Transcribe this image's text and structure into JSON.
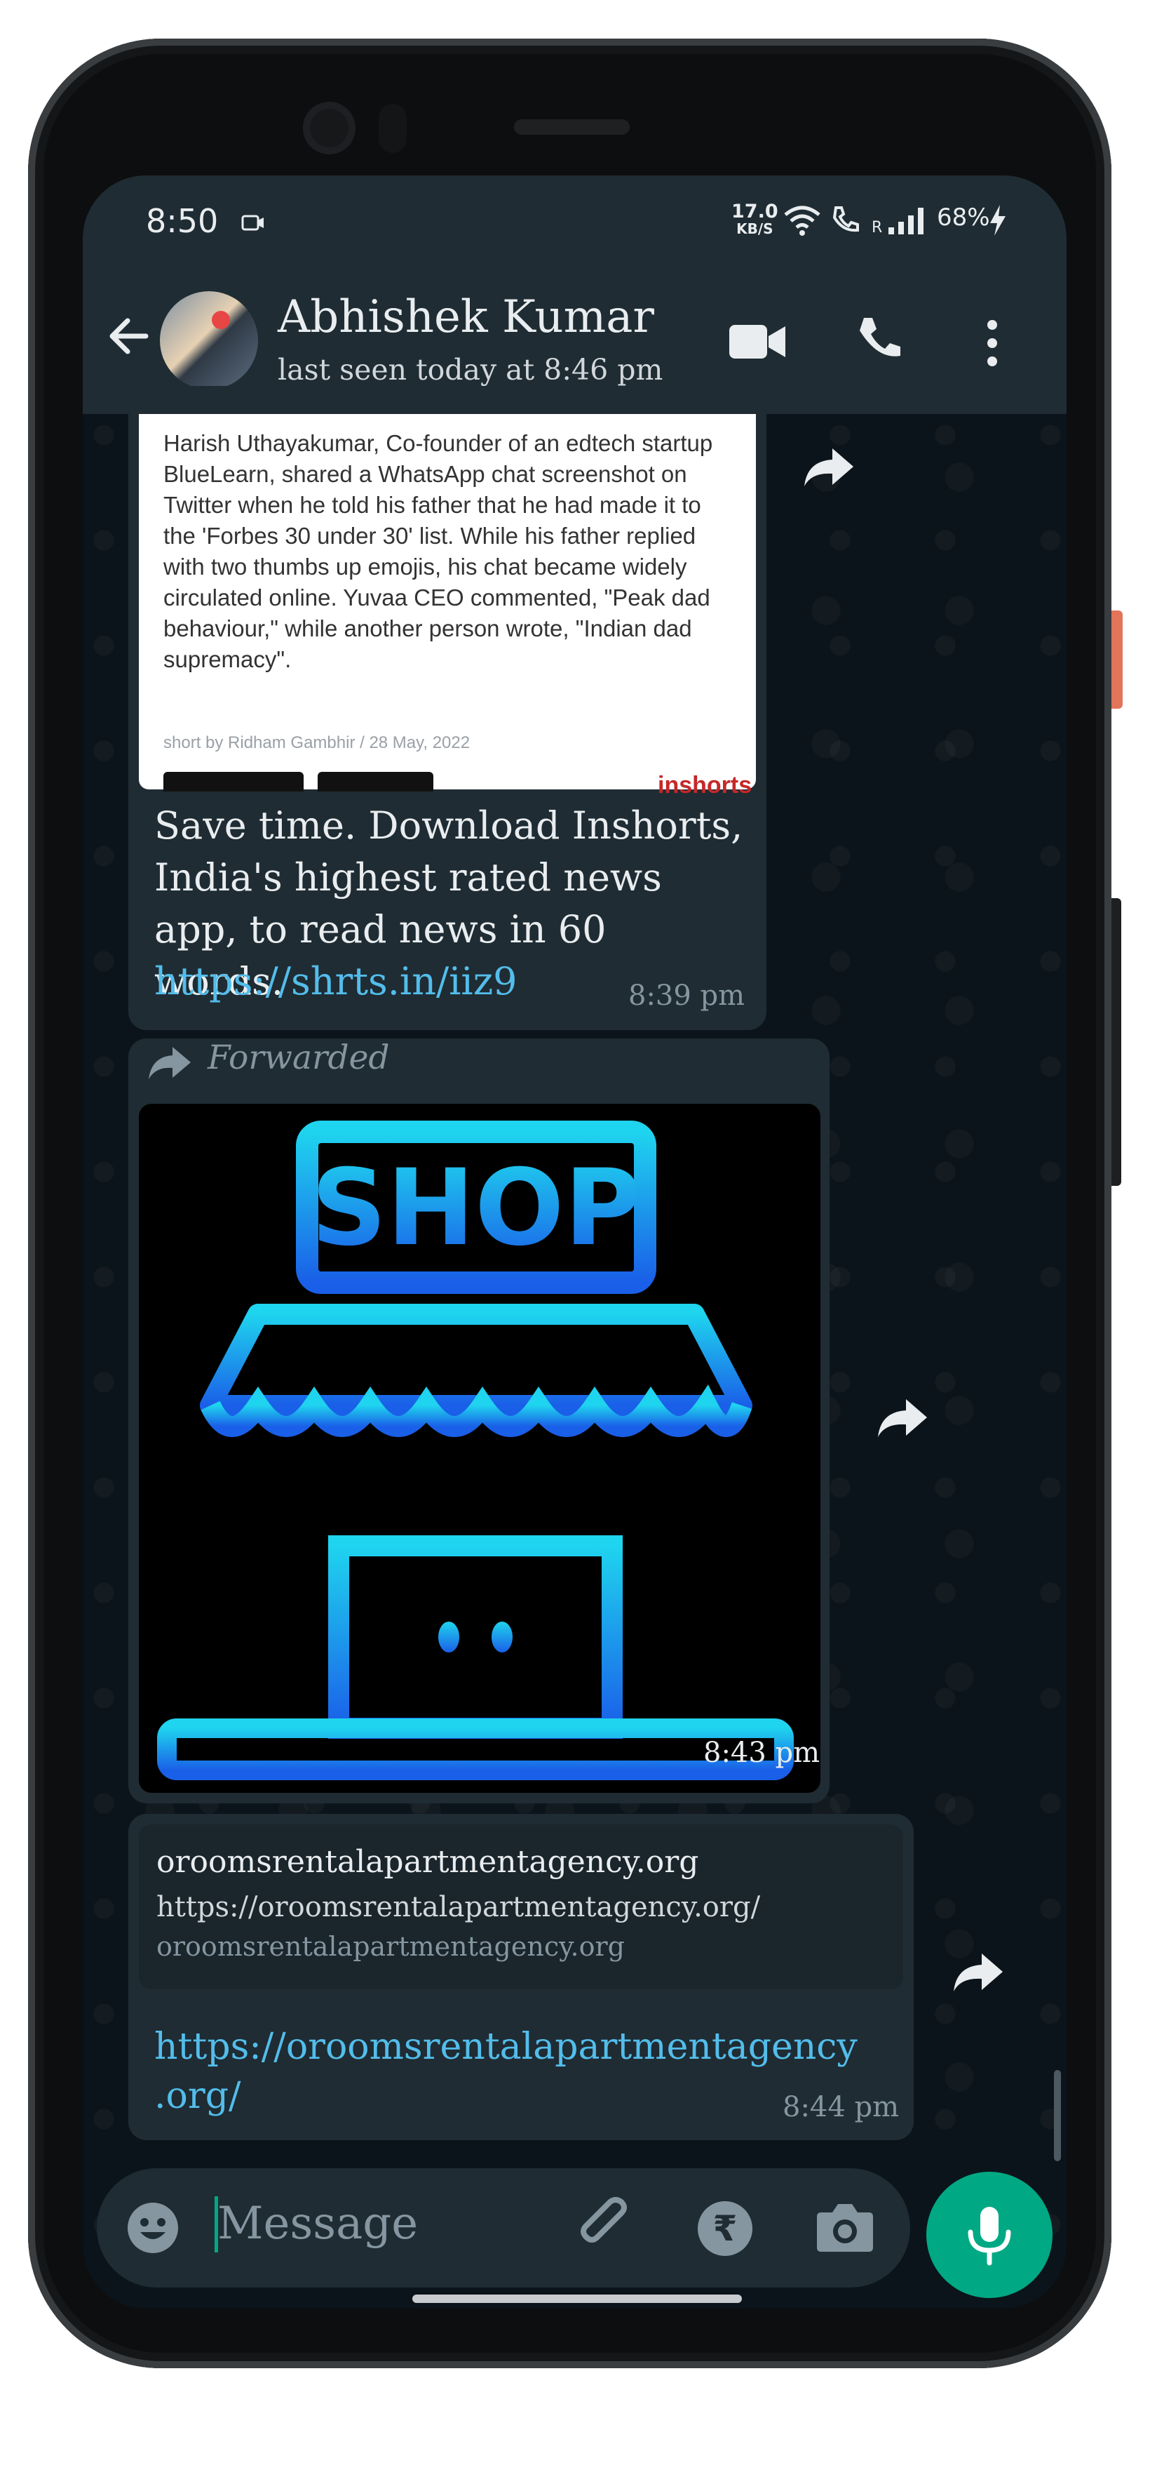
{
  "status_bar": {
    "time": "8:50",
    "net_speed": "17.0",
    "net_unit": "KB/S",
    "signal_label": "R",
    "battery": "68%"
  },
  "header": {
    "contact_name": "Abhishek Kumar",
    "last_seen": "last seen today at 8:46 pm"
  },
  "messages": [
    {
      "type": "news",
      "article": "Harish Uthayakumar, Co-founder of an edtech startup BlueLearn, shared a WhatsApp chat screenshot on Twitter when he told his father that he had made it to the 'Forbes 30 under 30' list. While his father replied with two thumbs up emojis, his chat became widely circulated online. Yuvaa CEO commented, \"Peak dad behaviour,\" while another person wrote, \"Indian dad supremacy\".",
      "byline": "short by Ridham Gambhir / 28 May, 2022",
      "brand": "inshorts",
      "text": "Save time. Download Inshorts, India's highest rated news app, to read news in 60 words.",
      "link": "https://shrts.in/iiz9",
      "time": "8:39 pm"
    },
    {
      "type": "image",
      "forwarded_label": "Forwarded",
      "image_text": "SHOP",
      "time": "8:43 pm"
    },
    {
      "type": "link",
      "preview_title": "oroomsrentalapartmentagency.org",
      "preview_url": "https://oroomsrentalapartmentagency.org/",
      "preview_domain": "oroomsrentalapartmentagency.org",
      "link_line1": "https://oroomsrentalapartmentagency",
      "link_line2": ".org/",
      "time": "8:44 pm"
    }
  ],
  "composer": {
    "placeholder": "Message"
  },
  "icons": [
    "back-arrow-icon",
    "video-call-icon",
    "voice-call-icon",
    "more-options-icon",
    "forward-icon",
    "emoji-icon",
    "attach-icon",
    "rupee-payment-icon",
    "camera-icon",
    "mic-icon"
  ],
  "colors": {
    "header_bg": "#1f2c33",
    "chat_bg": "#0b141a",
    "bubble_bg": "#1f2c33",
    "accent": "#00a884",
    "link": "#53bdeb"
  }
}
